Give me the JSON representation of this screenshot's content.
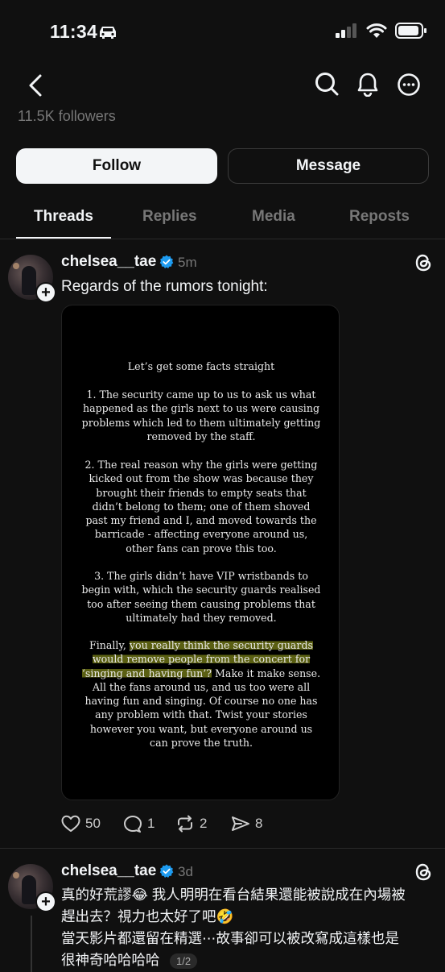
{
  "status_bar": {
    "time": "11:34"
  },
  "profile": {
    "followers_text": "11.5K followers"
  },
  "actions": {
    "follow_label": "Follow",
    "message_label": "Message"
  },
  "tabs": [
    {
      "label": "Threads"
    },
    {
      "label": "Replies"
    },
    {
      "label": "Media"
    },
    {
      "label": "Reposts"
    }
  ],
  "posts": [
    {
      "username": "chelsea__tae",
      "time": "5m",
      "text": "Regards of the rumors tonight:",
      "image": {
        "title": "Let’s get some facts straight",
        "p1": "1. The security came up to us to ask us what happened as the girls next to us were causing problems which led to them ultimately getting removed by the staff.",
        "p2": "2. The real reason why the girls were getting kicked out from the show was because they brought their friends to empty seats that didn’t belong to them; one of them shoved past my friend and I, and moved towards the barricade - affecting everyone around us, other fans can prove this too.",
        "p3": "3. The girls didn’t have VIP wristbands to begin with, which the security guards realised too after seeing them causing problems that ultimately had they removed.",
        "p4_prefix": "Finally, ",
        "p4_highlight": "you really think the security guards would remove people from the concert for ‘singing and having fun’?",
        "p4_rest": " Make it make sense. All the fans around us, and us too were all having fun and singing. Of course no one has any problem with that. Twist your stories however you want, but everyone around us can prove the truth."
      },
      "likes": "50",
      "replies": "1",
      "reposts": "2",
      "shares": "8"
    },
    {
      "username": "chelsea__tae",
      "time": "3d",
      "line1": "真的好荒謬😂 我人明明在看台結果還能被說成在內場被",
      "line2": "趕出去？視力也太好了吧🤣",
      "line3": "當天影片都還留在精選⋯故事卻可以被改寫成這樣也是",
      "line4": "很神奇哈哈哈哈",
      "page_indicator": "1/2"
    }
  ]
}
